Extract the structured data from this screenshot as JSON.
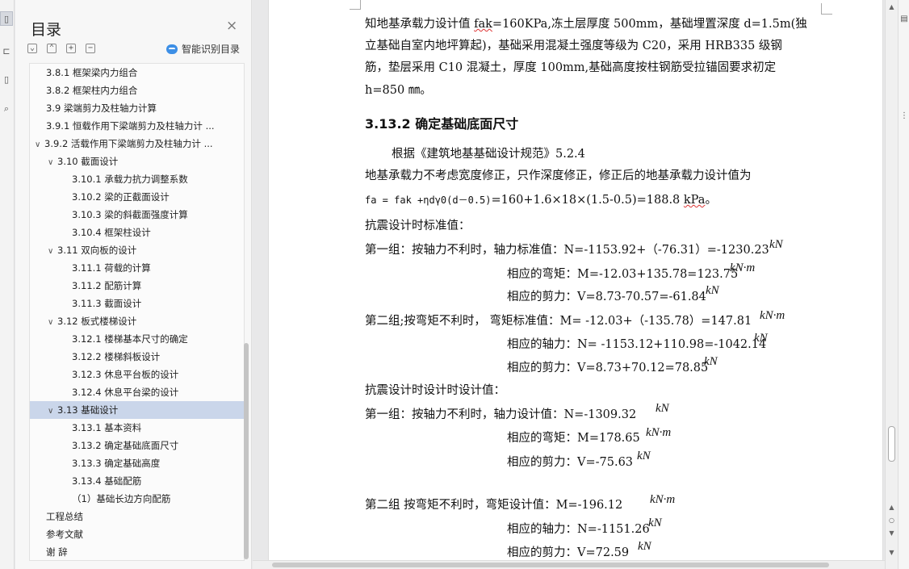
{
  "toc": {
    "title": "目录",
    "close_label": "×",
    "smart_label": "智能识别目录",
    "items": [
      {
        "label": "3.8.1 框架梁内力组合",
        "indent": 0,
        "chev": ""
      },
      {
        "label": "3.8.2 框架柱内力组合",
        "indent": 0,
        "chev": ""
      },
      {
        "label": "3.9  梁端剪力及柱轴力计算",
        "indent": 0,
        "chev": ""
      },
      {
        "label": "3.9.1  恒载作用下梁端剪力及柱轴力计 ...",
        "indent": 0,
        "chev": ""
      },
      {
        "label": "3.9.2  活载作用下梁端剪力及柱轴力计 ...",
        "indent": 0,
        "chev": "∨"
      },
      {
        "label": "3.10  截面设计",
        "indent": 1,
        "chev": "∨"
      },
      {
        "label": "3.10.1  承载力抗力调整系数",
        "indent": 2,
        "chev": ""
      },
      {
        "label": "3.10.2  梁的正截面设计",
        "indent": 2,
        "chev": ""
      },
      {
        "label": "3.10.3 梁的斜截面强度计算",
        "indent": 2,
        "chev": ""
      },
      {
        "label": "3.10.4 框架柱设计",
        "indent": 2,
        "chev": ""
      },
      {
        "label": "3.11  双向板的设计",
        "indent": 1,
        "chev": "∨"
      },
      {
        "label": "3.11.1 荷载的计算",
        "indent": 2,
        "chev": ""
      },
      {
        "label": "3.11.2 配筋计算",
        "indent": 2,
        "chev": ""
      },
      {
        "label": "3.11.3 截面设计",
        "indent": 2,
        "chev": ""
      },
      {
        "label": "3.12 板式楼梯设计",
        "indent": 1,
        "chev": "∨"
      },
      {
        "label": "3.12.1 楼梯基本尺寸的确定",
        "indent": 2,
        "chev": ""
      },
      {
        "label": "3.12.2 楼梯斜板设计",
        "indent": 2,
        "chev": ""
      },
      {
        "label": "3.12.3 休息平台板的设计",
        "indent": 2,
        "chev": ""
      },
      {
        "label": "3.12.4 休息平台梁的设计",
        "indent": 2,
        "chev": ""
      },
      {
        "label": "3.13 基础设计",
        "indent": 1,
        "chev": "∨",
        "selected": true
      },
      {
        "label": "3.13.1  基本资料",
        "indent": 2,
        "chev": ""
      },
      {
        "label": "3.13.2  确定基础底面尺寸",
        "indent": 2,
        "chev": ""
      },
      {
        "label": "3.13.3  确定基础高度",
        "indent": 2,
        "chev": ""
      },
      {
        "label": "3.13.4  基础配筋",
        "indent": 2,
        "chev": ""
      },
      {
        "label": "（1）基础长边方向配筋",
        "indent": 2,
        "chev": ""
      },
      {
        "label": "工程总结",
        "indent": 0,
        "chev": ""
      },
      {
        "label": "参考文献",
        "indent": 0,
        "chev": ""
      },
      {
        "label": "谢  辞",
        "indent": 0,
        "chev": ""
      }
    ]
  },
  "doc": {
    "p1_l1a": "知地基承载力设计值 ",
    "p1_l1b": "fak",
    "p1_l1c": "=160KPa,冻土层厚度 500mm，基础埋置深度 d=1.5m(独",
    "p1_l2": "立基础自室内地坪算起)，基础采用混凝土强度等级为 C20，采用 HRB335 级钢",
    "p1_l3": "筋，垫层采用 C10 混凝土，厚度 100mm,基础高度按柱钢筋受拉锚固要求初定",
    "p1_l4": "h=850 ㎜。",
    "heading": "3.13.2  确定基础底面尺寸",
    "p2_l1": "根据《建筑地基基础设计规范》5.2.4",
    "p2_l2": "地基承载力不考虑宽度修正，只作深度修正，修正后的地基承载力设计值为",
    "formula_left": "fa = fak +ηdγ0(d－0.5)",
    "formula_right": "=160+1.6×18×(1.5-0.5)=188.8 ",
    "formula_unit": "kPa",
    "formula_end": "。",
    "std_title": "抗震设计时标准值：",
    "g1_label": "第一组：按轴力不利时，轴力标准值：N=-1153.92+（-76.31）=-1230.23",
    "g1_m": "相应的弯矩：M=-12.03+135.78=123.75",
    "g1_v": "相应的剪力：V=8.73-70.57=-61.84",
    "g2_label": "第二组;按弯矩不利时，  弯矩标准值：M= -12.03+（-135.78）=147.81",
    "g2_n": "相应的轴力：N= -1153.12+110.98=-1042.14",
    "g2_v": "相应的剪力：V=8.73+70.12=78.85",
    "des_title": "抗震设计时设计时设计值：",
    "d1_label": "第一组：按轴力不利时，轴力设计值：N=-1309.32",
    "d1_m": "相应的弯矩：M=178.65",
    "d1_v": "相应的剪力：V=-75.63",
    "d2_label": "第二组   按弯矩不利时，弯矩设计值：M=-196.12",
    "d2_n": "相应的轴力：N=-1151.26",
    "d2_v": "相应的剪力：V=72.59",
    "unit_kn": "kN",
    "unit_knm": "kN·m"
  }
}
